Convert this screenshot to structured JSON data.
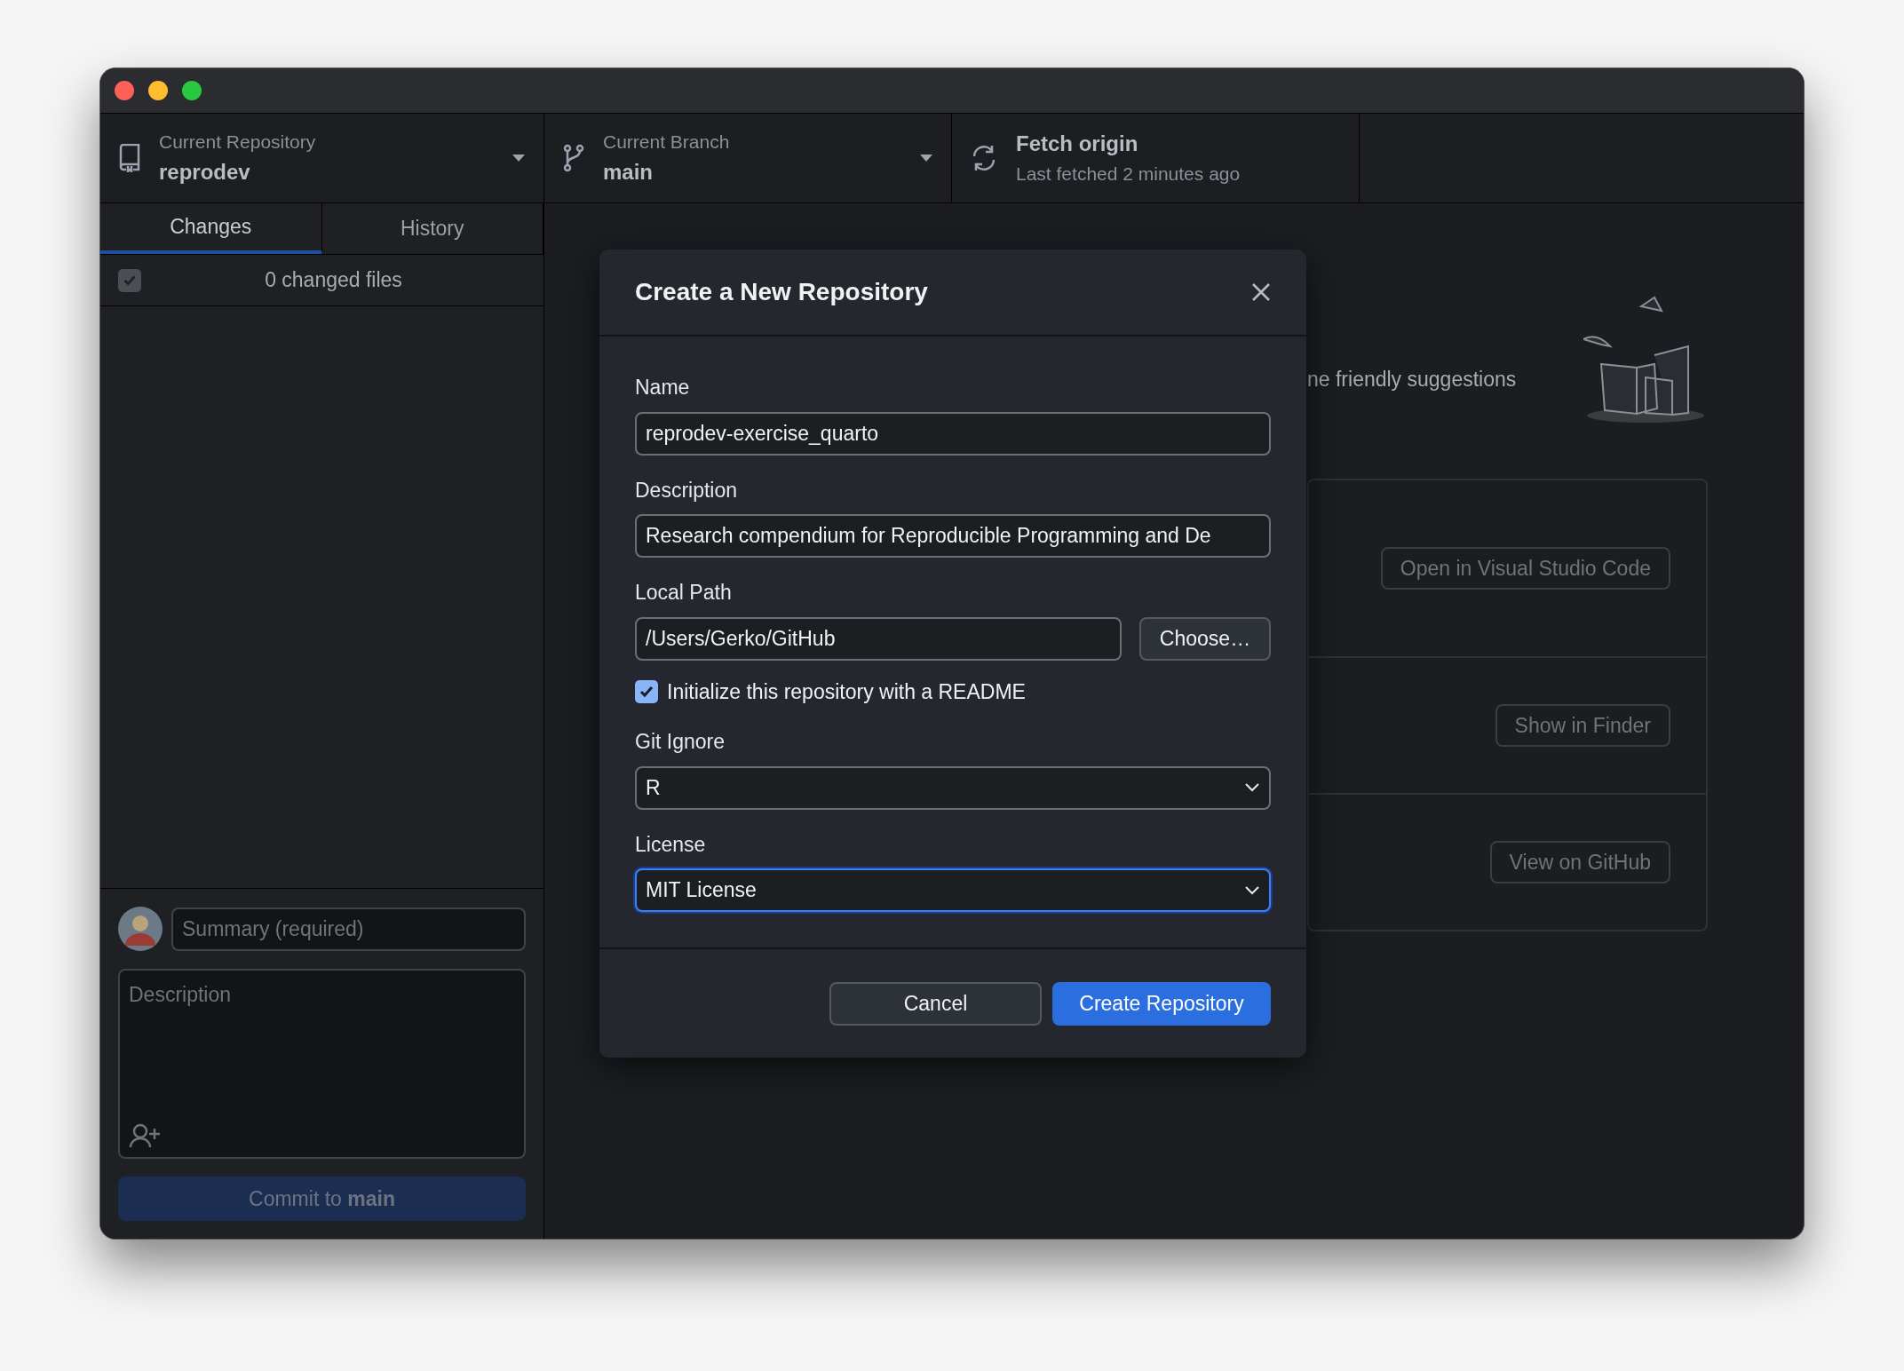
{
  "toolbar": {
    "repository": {
      "label": "Current Repository",
      "value": "reprodev"
    },
    "branch": {
      "label": "Current Branch",
      "value": "main"
    },
    "fetch": {
      "title": "Fetch origin",
      "subtitle": "Last fetched 2 minutes ago"
    }
  },
  "sidebar": {
    "tabs": [
      {
        "label": "Changes",
        "selected": true
      },
      {
        "label": "History",
        "selected": false
      }
    ],
    "changes": {
      "checked": true,
      "count_label": "0 changed files"
    },
    "commit": {
      "summary_placeholder": "Summary (required)",
      "description_placeholder": "Description",
      "button": "Commit to **main**"
    }
  },
  "main": {
    "suggestions_text": "ne friendly suggestions",
    "actions": [
      {
        "button": "Open in Visual Studio Code"
      },
      {
        "button": "Show in Finder"
      },
      {
        "button": "View on GitHub"
      }
    ]
  },
  "dialog": {
    "title": "Create a New Repository",
    "fields": [
      {
        "kind": "text",
        "label": "Name",
        "value": "reprodev-exercise_quarto"
      },
      {
        "kind": "text",
        "label": "Description",
        "value": "Research compendium for Reproducible Programming and De"
      },
      {
        "kind": "path",
        "label": "Local Path",
        "value": "/Users/Gerko/GitHub",
        "button": "Choose…"
      },
      {
        "kind": "checkbox",
        "label": "Initialize this repository with a README",
        "checked": true
      },
      {
        "kind": "select",
        "label": "Git Ignore",
        "value": "R",
        "focused": false
      },
      {
        "kind": "select",
        "label": "License",
        "value": "MIT License",
        "focused": true
      }
    ],
    "buttons": [
      {
        "label": "Cancel",
        "primary": false
      },
      {
        "label": "Create Repository",
        "primary": true
      }
    ]
  }
}
